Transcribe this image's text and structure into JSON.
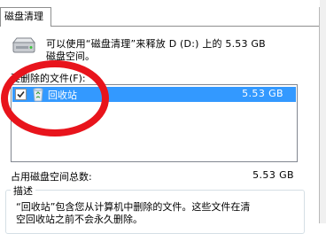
{
  "tabs": [
    {
      "label": "磁盘清理",
      "active": true
    }
  ],
  "drive_info": {
    "line1": "可以使用“磁盘清理”来释放 D (D:) 上的 5.53 GB",
    "line2": "磁盘空间。"
  },
  "files_to_delete": {
    "label": "要删除的文件(F):",
    "items": [
      {
        "name": "回收站",
        "size": "5.53 GB",
        "checked": true,
        "selected": true,
        "icon": "recycle-bin-icon"
      }
    ]
  },
  "total": {
    "label": "占用磁盘空间总数:",
    "value": "5.53 GB"
  },
  "description": {
    "title": "描述",
    "line1": "“回收站”包含您从计算机中删除的文件。这些文件在清",
    "line2": "空回收站之前不会永久删除。"
  },
  "colors": {
    "selection": "#3399ff",
    "annotation": "#e8141c"
  }
}
